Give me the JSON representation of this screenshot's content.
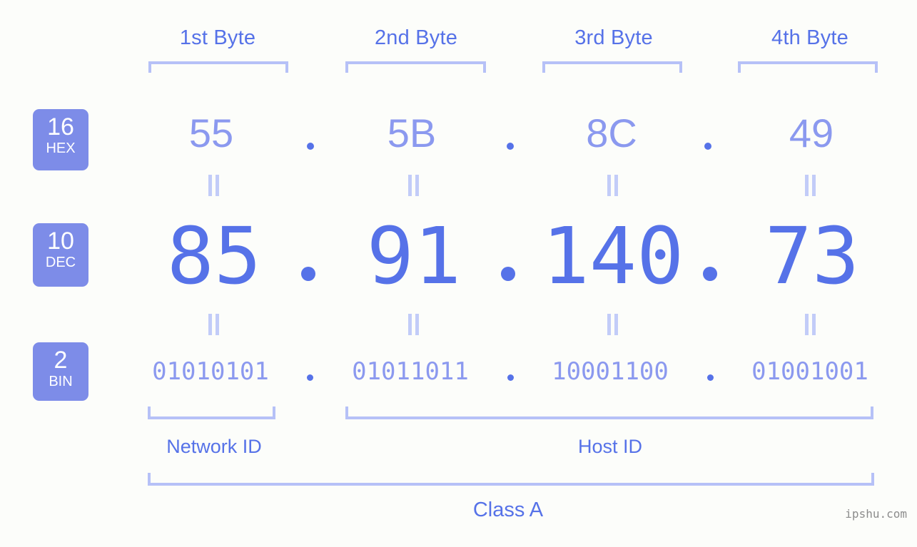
{
  "meta": {
    "background_color": "#fcfdfa",
    "accent_color": "#5672e8",
    "light_accent_color": "#8b99ef",
    "bracket_color": "#b6c1f7",
    "badge_color": "#7d8ce8",
    "watermark": "ipshu.com"
  },
  "byte_headers": [
    {
      "label": "1st Byte"
    },
    {
      "label": "2nd Byte"
    },
    {
      "label": "3rd Byte"
    },
    {
      "label": "4th Byte"
    }
  ],
  "rows": [
    {
      "badge_number": "16",
      "badge_abbr": "HEX",
      "values": [
        "55",
        "5B",
        "8C",
        "49"
      ]
    },
    {
      "badge_number": "10",
      "badge_abbr": "DEC",
      "values": [
        "85",
        "91",
        "140",
        "73"
      ]
    },
    {
      "badge_number": "2",
      "badge_abbr": "BIN",
      "values": [
        "01010101",
        "01011011",
        "10001100",
        "01001001"
      ]
    }
  ],
  "separator": ".",
  "equality_symbol": "=",
  "id_labels": [
    {
      "label": "Network ID"
    },
    {
      "label": "Host ID"
    }
  ],
  "class_label": "Class A",
  "chart_data": {
    "type": "table",
    "title": "IP Address Byte Breakdown",
    "categories": [
      "1st Byte",
      "2nd Byte",
      "3rd Byte",
      "4th Byte"
    ],
    "series": [
      {
        "name": "HEX",
        "values": [
          "55",
          "5B",
          "8C",
          "49"
        ]
      },
      {
        "name": "DEC",
        "values": [
          85,
          91,
          140,
          73
        ]
      },
      {
        "name": "BIN",
        "values": [
          "01010101",
          "01011011",
          "10001100",
          "01001001"
        ]
      }
    ],
    "annotations": [
      "Network ID",
      "Host ID",
      "Class A"
    ],
    "network_id_bytes": [
      1
    ],
    "host_id_bytes": [
      2,
      3,
      4
    ],
    "ip_address": "85.91.140.73",
    "address_class": "Class A"
  }
}
